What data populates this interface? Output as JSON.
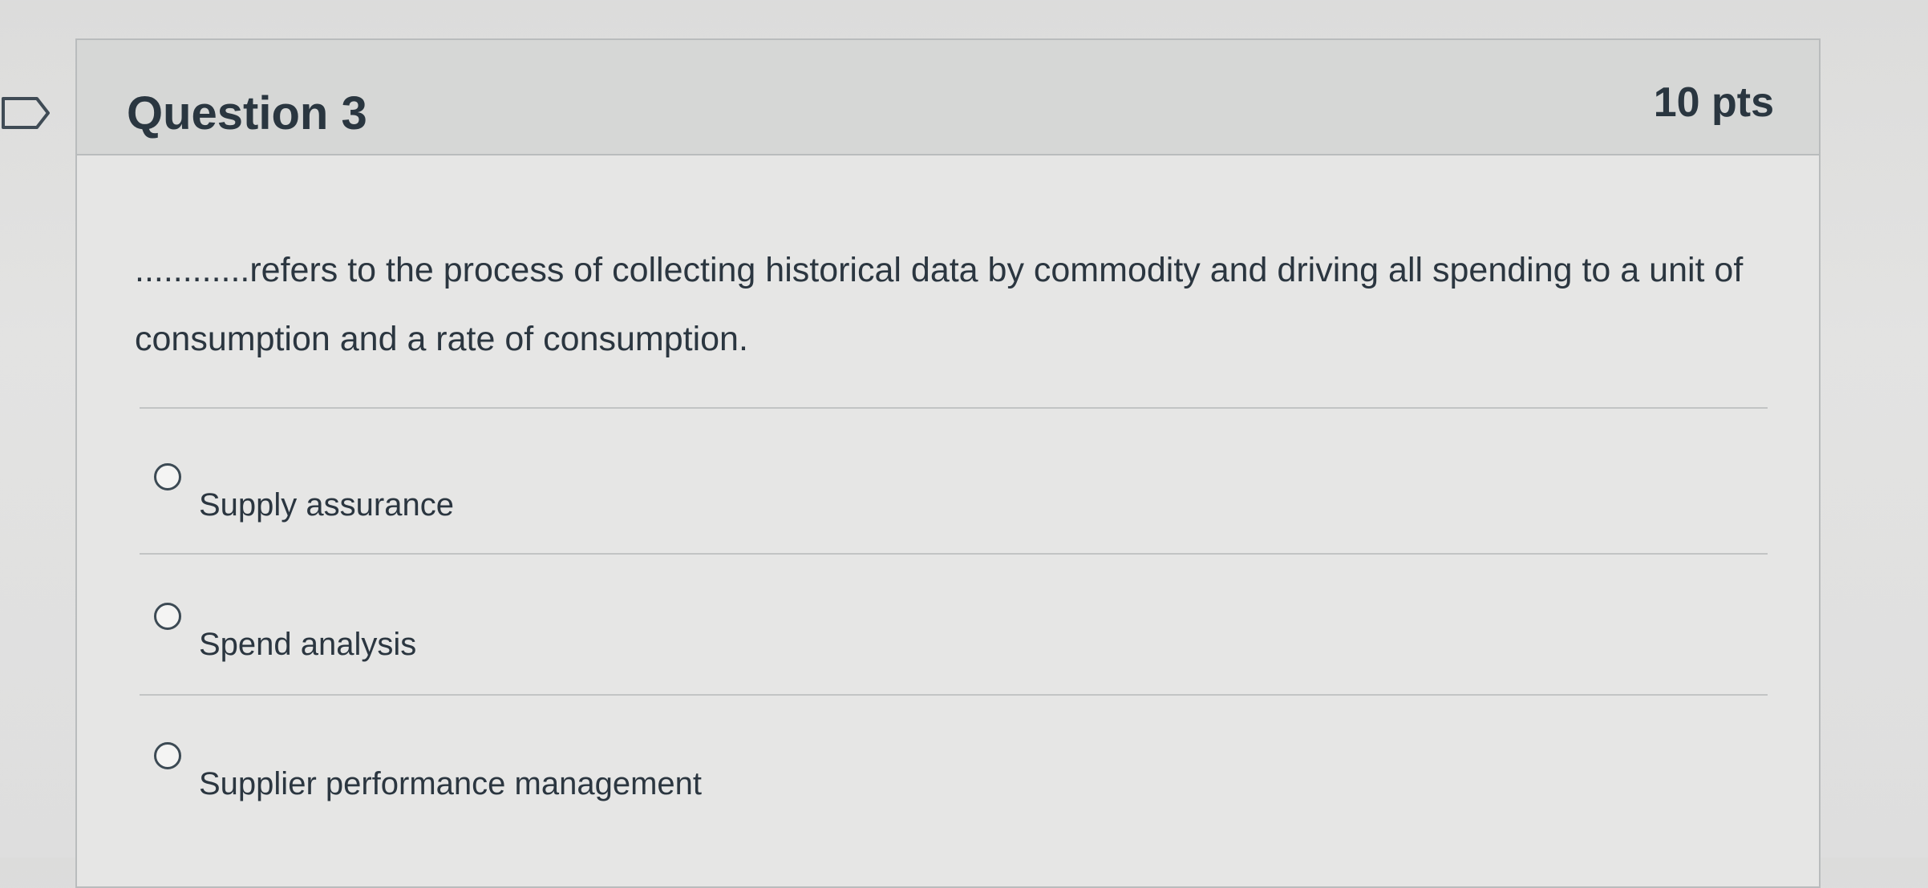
{
  "question": {
    "title": "Question 3",
    "points": "10 pts",
    "text": "............refers to the process of collecting historical data by commodity and driving all spending to a unit of consumption and a rate of consumption."
  },
  "answers": [
    {
      "label": "Supply assurance",
      "selected": false
    },
    {
      "label": "Spend analysis",
      "selected": false
    },
    {
      "label": "Supplier performance management",
      "selected": false
    }
  ],
  "icons": {
    "flag": "flag-icon",
    "radio": "radio-icon"
  }
}
